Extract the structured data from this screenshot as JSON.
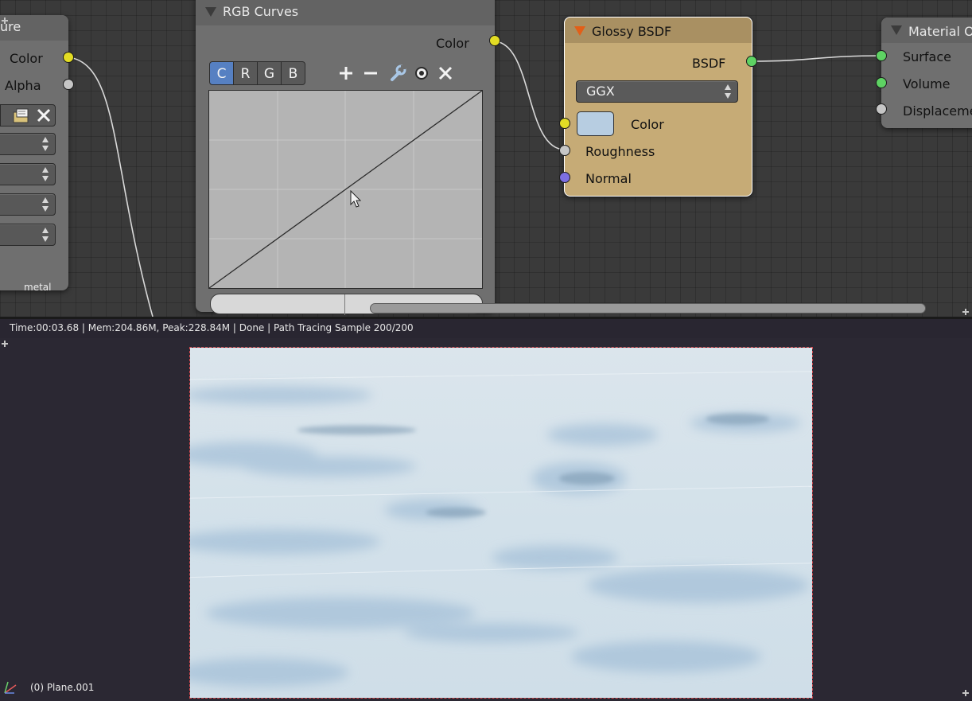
{
  "node_editor": {
    "left_node": {
      "title": "ure",
      "outputs": [
        "Color",
        "Alpha"
      ],
      "footer_label": "metal"
    },
    "rgb_curves": {
      "title": "RGB Curves",
      "output": "Color",
      "channels": [
        "C",
        "R",
        "G",
        "B"
      ],
      "active_channel": "C",
      "tools": [
        "plus-icon",
        "minus-icon",
        "wrench-icon",
        "circle-icon",
        "x-icon"
      ]
    },
    "glossy_bsdf": {
      "title": "Glossy BSDF",
      "output": "BSDF",
      "distribution": "GGX",
      "inputs": [
        "Color",
        "Roughness",
        "Normal"
      ],
      "color_swatch": "#b7cde1",
      "header_color": "#a99062"
    },
    "material_output": {
      "title": "Material O",
      "inputs": [
        "Surface",
        "Volume",
        "Displaceme"
      ]
    }
  },
  "status": {
    "render_info": "Time:00:03.68 | Mem:204.86M, Peak:228.84M | Done | Path Tracing Sample 200/200"
  },
  "image_editor": {
    "object_label": "(0) Plane.001"
  },
  "colors": {
    "socket_color": "#e3dd24",
    "socket_float": "#c6c6c6",
    "socket_shader": "#5ed263",
    "socket_vector": "#7d6fe2",
    "active_tab": "#5680c2",
    "render_border": "#d2484e"
  }
}
